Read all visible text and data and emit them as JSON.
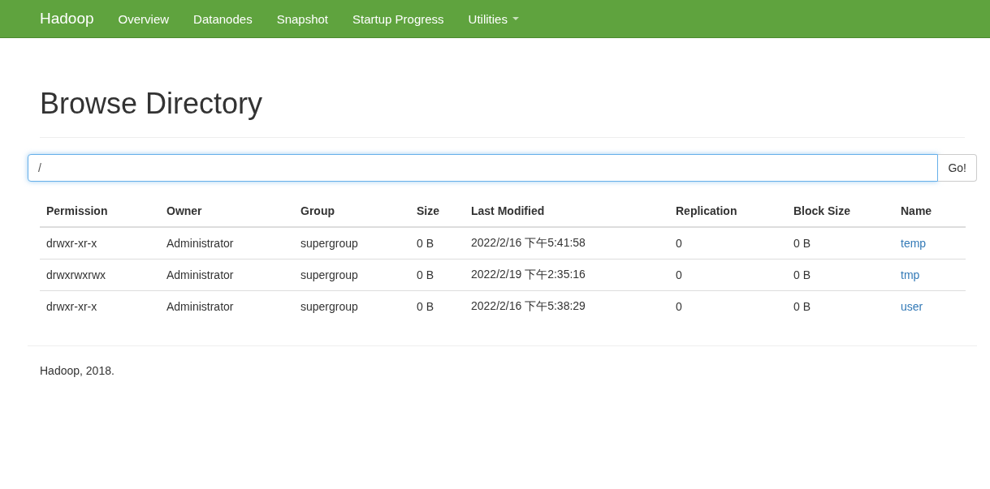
{
  "navbar": {
    "brand": "Hadoop",
    "items": [
      {
        "label": "Overview",
        "kind": "link"
      },
      {
        "label": "Datanodes",
        "kind": "link"
      },
      {
        "label": "Snapshot",
        "kind": "link"
      },
      {
        "label": "Startup Progress",
        "kind": "link"
      },
      {
        "label": "Utilities",
        "kind": "dropdown"
      }
    ]
  },
  "title": "Browse Directory",
  "path_field": {
    "value": "/"
  },
  "go_button": "Go!",
  "table": {
    "columns": [
      "Permission",
      "Owner",
      "Group",
      "Size",
      "Last Modified",
      "Replication",
      "Block Size",
      "Name"
    ],
    "rows": [
      [
        "drwxr-xr-x",
        "Administrator",
        "supergroup",
        "0 B",
        "2022/2/16 下午5:41:58",
        "0",
        "0 B",
        "temp"
      ],
      [
        "drwxrwxrwx",
        "Administrator",
        "supergroup",
        "0 B",
        "2022/2/19 下午2:35:16",
        "0",
        "0 B",
        "tmp"
      ],
      [
        "drwxr-xr-x",
        "Administrator",
        "supergroup",
        "0 B",
        "2022/2/16 下午5:38:29",
        "0",
        "0 B",
        "user"
      ]
    ]
  },
  "footer": "Hadoop, 2018."
}
